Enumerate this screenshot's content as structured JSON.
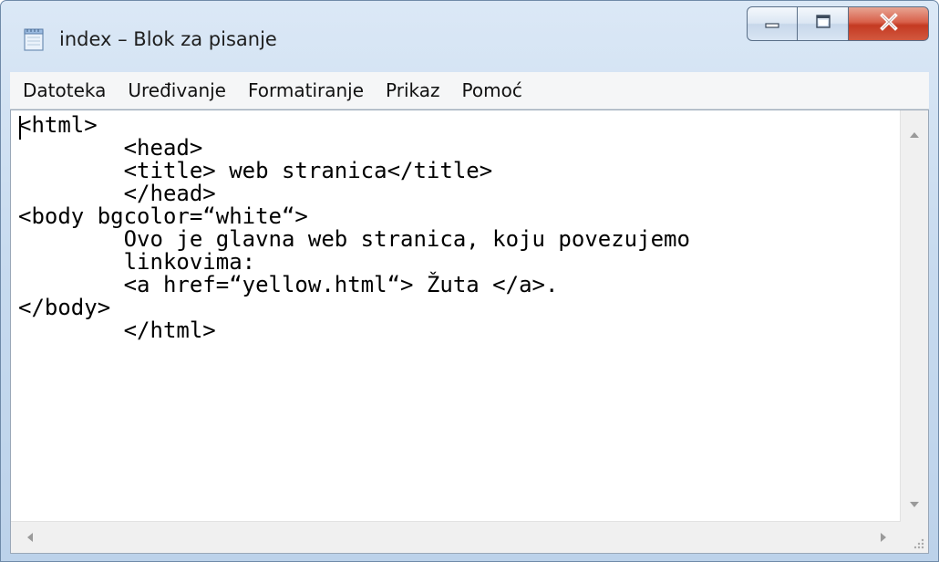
{
  "window": {
    "title": "index – Blok za pisanje",
    "app_icon": "notepad-icon",
    "buttons": {
      "minimize_icon": "minimize-icon",
      "maximize_icon": "maximize-icon",
      "close_icon": "close-icon"
    }
  },
  "menu": {
    "items": [
      {
        "label": "Datoteka"
      },
      {
        "label": "Uređivanje"
      },
      {
        "label": "Formatiranje"
      },
      {
        "label": "Prikaz"
      },
      {
        "label": "Pomoć"
      }
    ]
  },
  "editor": {
    "content": "<html>\n        <head>\n        <title> web stranica</title>\n        </head>\n<body bgcolor=“white“>\n        Ovo je glavna web stranica, koju povezujemo\n        linkovima:\n        <a href=“yellow.html“> Žuta </a>.\n</body>\n        </html>"
  },
  "colors": {
    "frame": "#c8dbef",
    "close_button": "#c43a22",
    "menubar": "#f5f6f7",
    "editor_bg": "#ffffff"
  }
}
